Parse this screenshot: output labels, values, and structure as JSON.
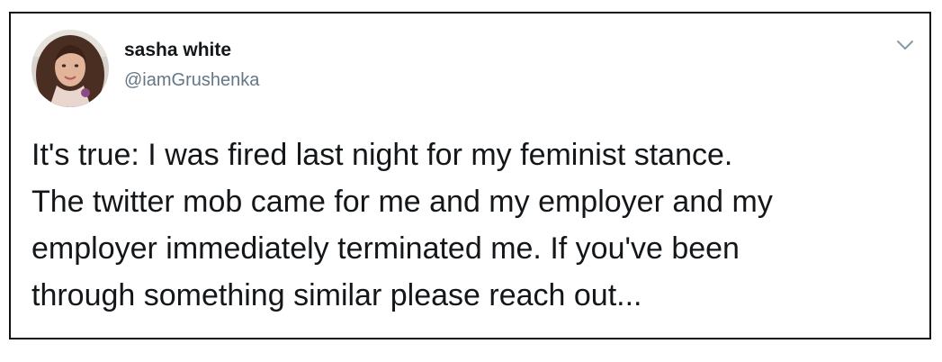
{
  "tweet": {
    "author": {
      "display_name": "sasha white",
      "handle": "@iamGrushenka",
      "avatar_icon": "profile-photo"
    },
    "menu_icon": "chevron-down-icon",
    "text_lines": [
      "It's true: I was fired last night for my feminist stance.",
      "The twitter mob came for me and my employer and my",
      "employer immediately terminated me. If you've been",
      "through something similar please reach out..."
    ]
  },
  "colors": {
    "border": "#111111",
    "name_text": "#14171a",
    "handle_text": "#657786",
    "chevron": "#8899a6"
  }
}
